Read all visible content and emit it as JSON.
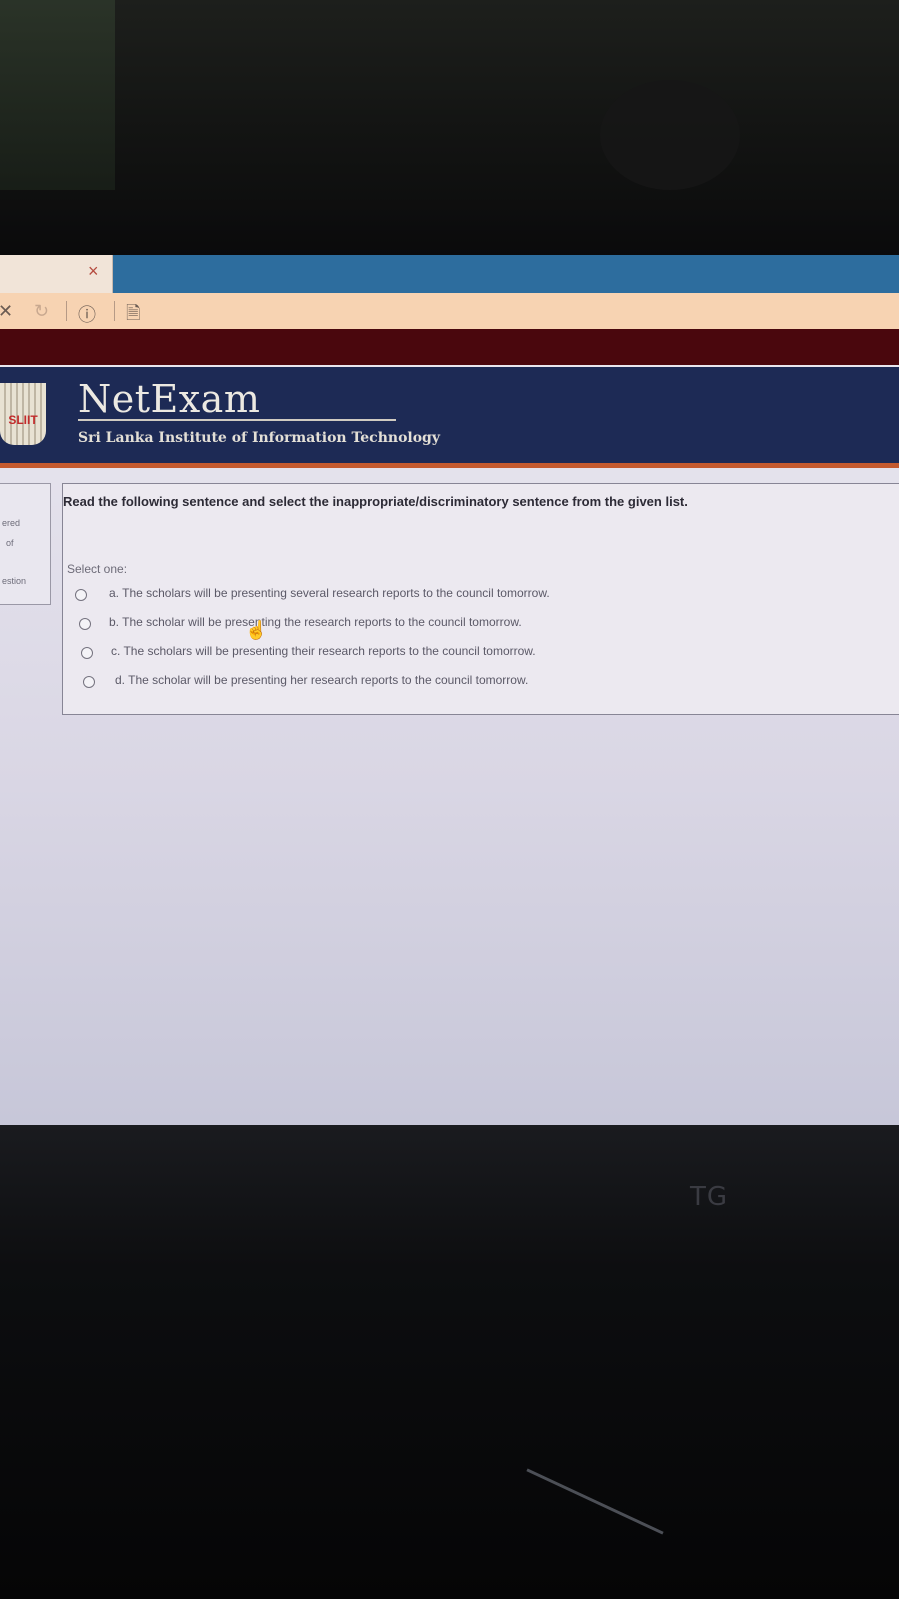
{
  "browser": {
    "tab_close_glyph": "×",
    "toolbar_stop_glyph": "✕",
    "toolbar_reload_glyph": "↻",
    "toolbar_info_glyph": "ⓘ",
    "toolbar_page_glyph": "🗎"
  },
  "header": {
    "crest_text": "SLIIT",
    "brand": "NetExam",
    "subtitle": "Sri Lanka Institute of Information Technology"
  },
  "sidebar": {
    "fragment_1": "ered",
    "fragment_2": "of",
    "fragment_3": "estion"
  },
  "question": {
    "text": "Read the following sentence and select the inappropriate/discriminatory sentence from the given list.",
    "select_label": "Select one:",
    "options": [
      {
        "label": "a. The scholars will be presenting several research reports to the council tomorrow."
      },
      {
        "label": "b. The scholar will be presenting the research reports to the council tomorrow."
      },
      {
        "label": "c. The scholars will be presenting their research reports to the council tomorrow."
      },
      {
        "label": "d. The scholar will be presenting her research reports to the council tomorrow."
      }
    ]
  },
  "monitor": {
    "logo": "TG"
  },
  "colors": {
    "tabstrip": "#2d6d9e",
    "toolbar": "#f7d3b2",
    "maroon_bar": "#4a070d",
    "header": "#1d2a55",
    "header_stripe": "#c45a2f"
  }
}
